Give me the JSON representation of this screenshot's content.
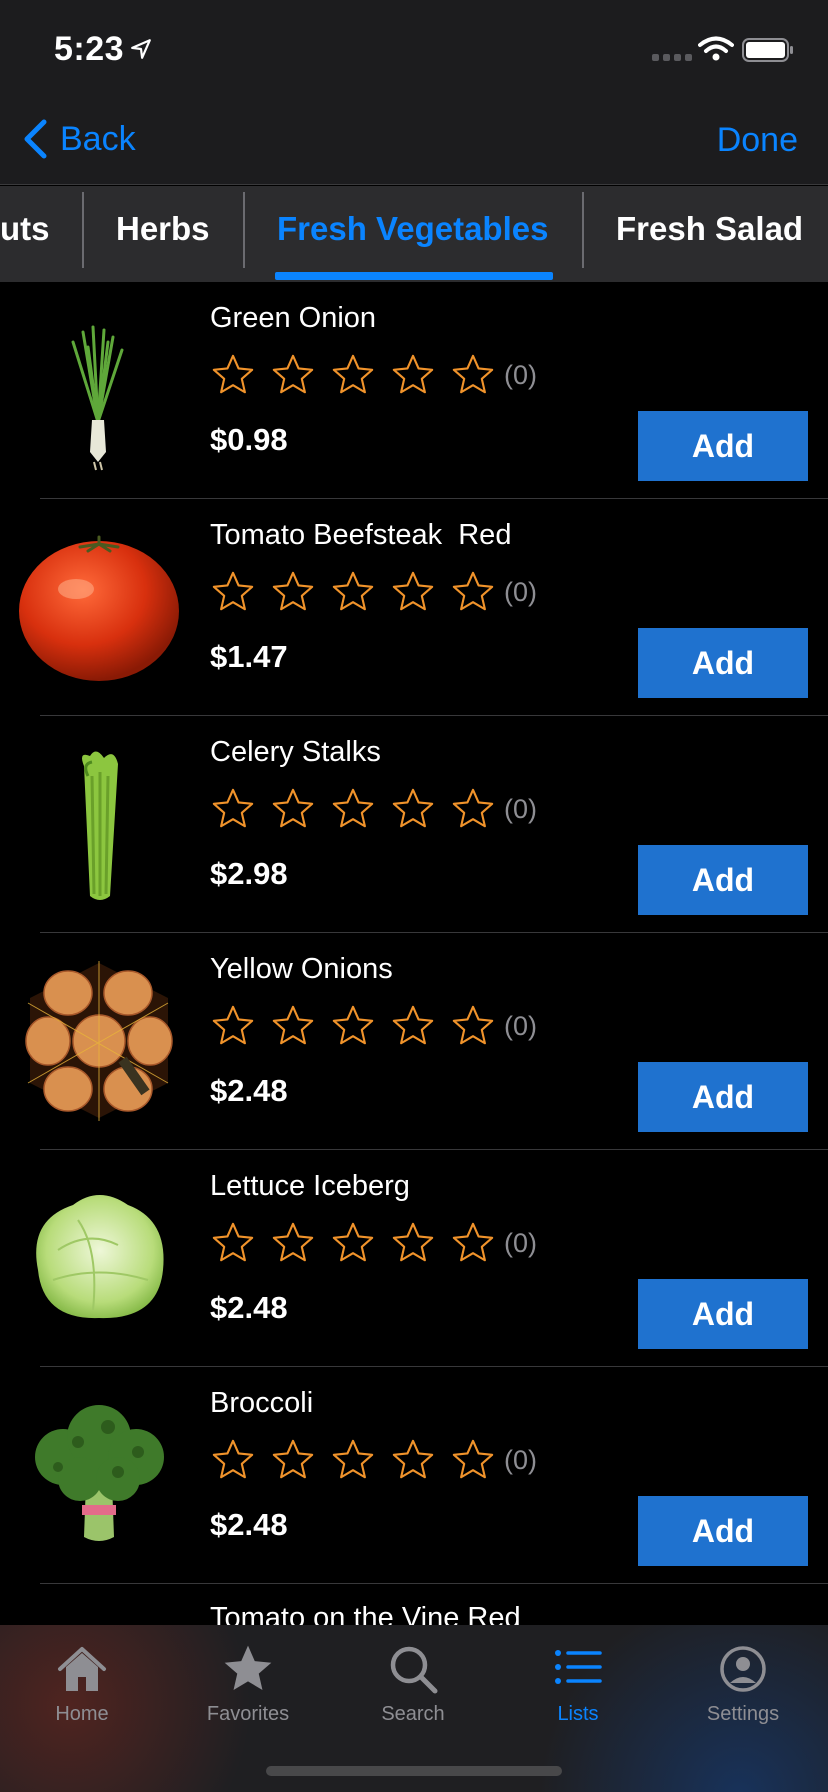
{
  "status": {
    "time": "5:23"
  },
  "nav": {
    "back_label": "Back",
    "done_label": "Done"
  },
  "categories": [
    {
      "label": "uts",
      "active": false
    },
    {
      "label": "Herbs",
      "active": false
    },
    {
      "label": "Fresh Vegetables",
      "active": true
    },
    {
      "label": "Fresh Salad",
      "active": false
    }
  ],
  "products": [
    {
      "name": "Green Onion",
      "rating": 0,
      "rating_count": "(0)",
      "price": "$0.98",
      "add_label": "Add",
      "image": "green-onion-image"
    },
    {
      "name": "Tomato Beefsteak  Red",
      "rating": 0,
      "rating_count": "(0)",
      "price": "$1.47",
      "add_label": "Add",
      "image": "tomato-image"
    },
    {
      "name": "Celery Stalks",
      "rating": 0,
      "rating_count": "(0)",
      "price": "$2.98",
      "add_label": "Add",
      "image": "celery-image"
    },
    {
      "name": "Yellow Onions",
      "rating": 0,
      "rating_count": "(0)",
      "price": "$2.48",
      "add_label": "Add",
      "image": "yellow-onions-image"
    },
    {
      "name": "Lettuce Iceberg",
      "rating": 0,
      "rating_count": "(0)",
      "price": "$2.48",
      "add_label": "Add",
      "image": "lettuce-image"
    },
    {
      "name": "Broccoli",
      "rating": 0,
      "rating_count": "(0)",
      "price": "$2.48",
      "add_label": "Add",
      "image": "broccoli-image"
    }
  ],
  "peek_item": "Tomato on the Vine Red",
  "tabbar": [
    {
      "label": "Home",
      "icon": "home-icon",
      "active": false
    },
    {
      "label": "Favorites",
      "icon": "star-icon",
      "active": false
    },
    {
      "label": "Search",
      "icon": "search-icon",
      "active": false
    },
    {
      "label": "Lists",
      "icon": "list-icon",
      "active": true
    },
    {
      "label": "Settings",
      "icon": "person-circle-icon",
      "active": false
    }
  ],
  "colors": {
    "accent": "#0a84ff",
    "add_button": "#1f72cf",
    "star": "#f0932b",
    "background": "#000000"
  }
}
